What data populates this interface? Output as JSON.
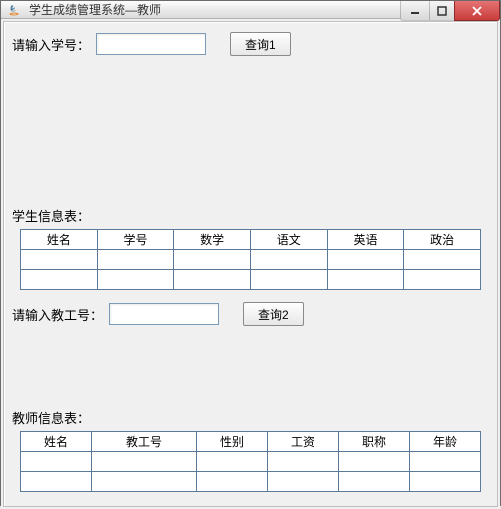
{
  "window": {
    "title": "学生成绩管理系统—教师"
  },
  "query1": {
    "label": "请输入学号：",
    "value": "",
    "button": "查询1"
  },
  "studentTable": {
    "caption": "学生信息表：",
    "headers": [
      "姓名",
      "学号",
      "数学",
      "语文",
      "英语",
      "政治"
    ],
    "rows": [
      [
        "",
        "",
        "",
        "",
        "",
        ""
      ],
      [
        "",
        "",
        "",
        "",
        "",
        ""
      ]
    ]
  },
  "query2": {
    "label": "请输入教工号：",
    "value": "",
    "button": "查询2"
  },
  "teacherTable": {
    "caption": "教师信息表：",
    "headers": [
      "姓名",
      "教工号",
      "性别",
      "工资",
      "职称",
      "年龄"
    ],
    "rows": [
      [
        "",
        "",
        "",
        "",
        "",
        ""
      ],
      [
        "",
        "",
        "",
        "",
        "",
        ""
      ]
    ]
  }
}
